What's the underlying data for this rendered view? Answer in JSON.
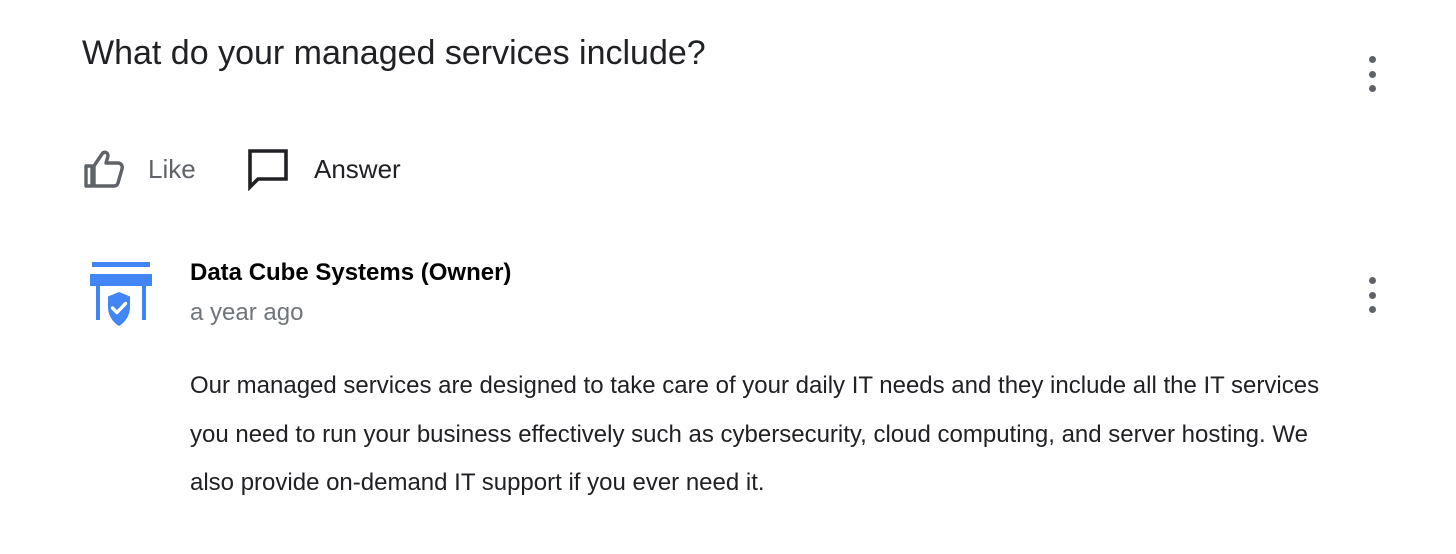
{
  "question": {
    "title": "What do your managed services include?",
    "menu_icon": "more-vert-icon"
  },
  "actions": {
    "like": {
      "label": "Like",
      "icon": "thumb-up-icon"
    },
    "answer": {
      "label": "Answer",
      "icon": "comment-icon"
    }
  },
  "answer": {
    "author": "Data Cube Systems (Owner)",
    "time": "a year ago",
    "avatar_icon": "verified-storefront-icon",
    "body": "Our managed services are designed to take care of your daily IT needs and they include all the IT services you need to run your business effectively such as cybersecurity, cloud computing, and server hosting. We also provide on-demand IT support if you ever need it.",
    "menu_icon": "more-vert-icon"
  },
  "colors": {
    "brand_blue": "#4285f4",
    "icon_gray": "#5f6368",
    "secondary_text": "#70757a"
  }
}
